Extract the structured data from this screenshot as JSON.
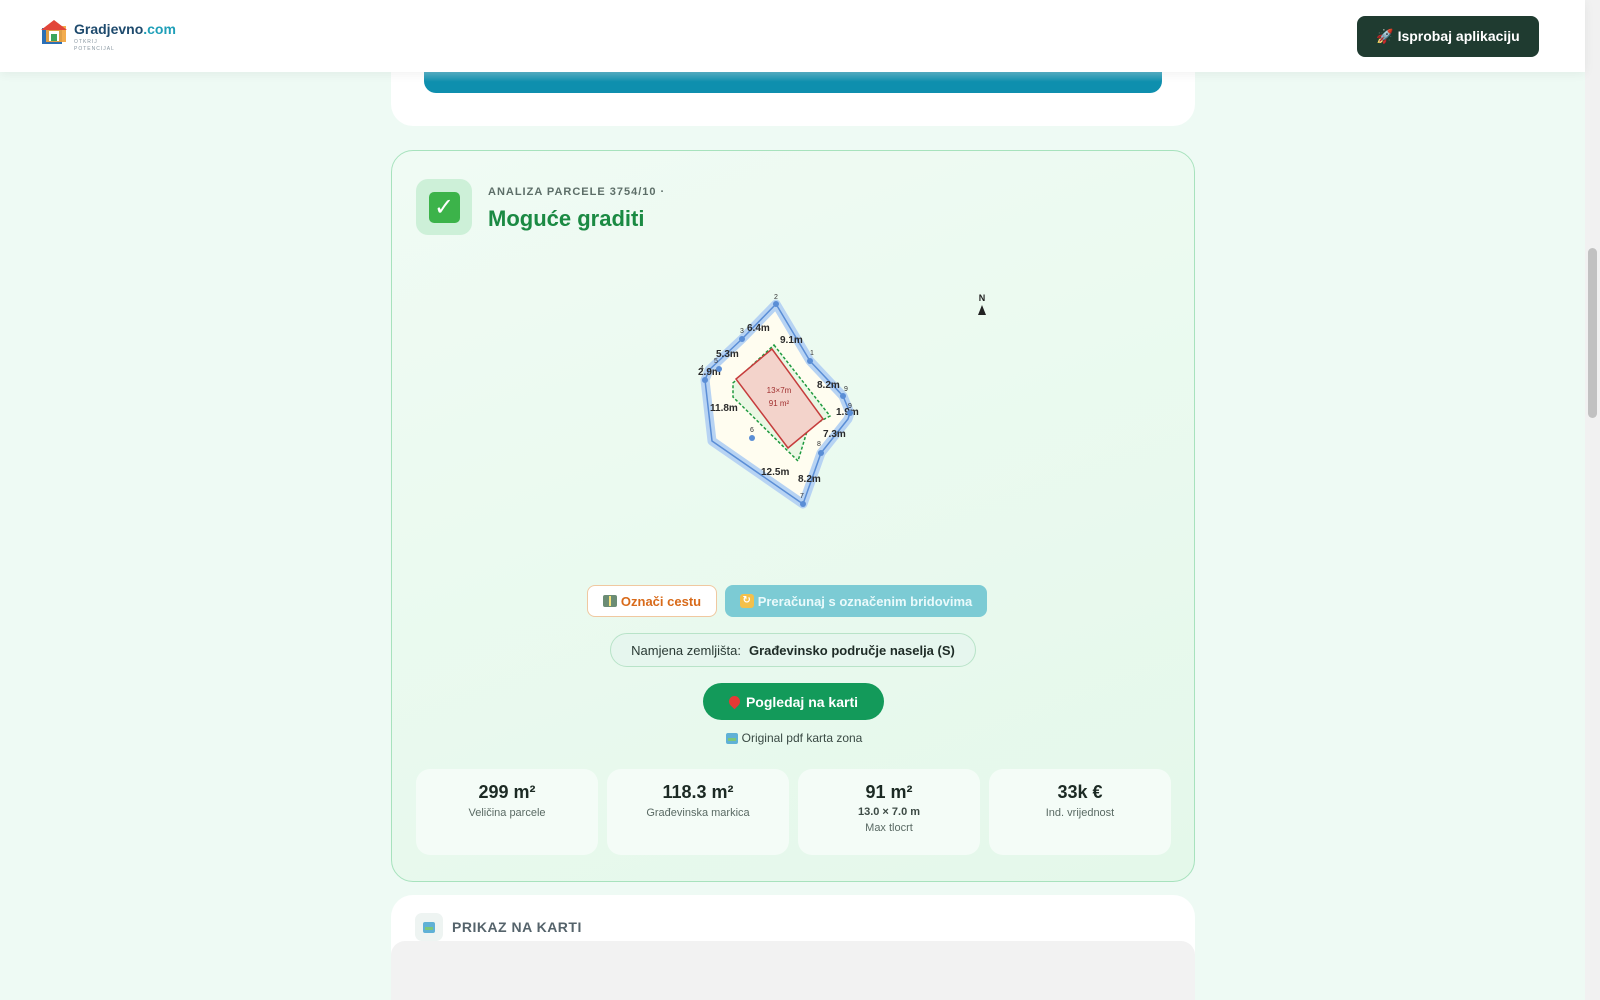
{
  "header": {
    "brand_name": "Gradjevno",
    "brand_domain": ".com",
    "brand_tagline": "OTKRIJ POTENCIJAL",
    "cta_label": "🚀 Isprobaj aplikaciju"
  },
  "analysis": {
    "parcel_label": "ANALIZA PARCELE 3754/10 ·",
    "status_title": "Moguće graditi",
    "status_icon": "check-icon",
    "diagram": {
      "north_label": "N",
      "footprint_dims": "13×7m",
      "footprint_area": "91 m²",
      "edge_labels": [
        "9.1m",
        "8.2m",
        "1.9m",
        "7.3m",
        "8.2m",
        "12.5m",
        "11.8m",
        "2.9m",
        "5.3m",
        "6.4m"
      ],
      "vertex_labels": [
        "1",
        "2",
        "3",
        "4",
        "5",
        "6",
        "7",
        "8",
        "9",
        "9"
      ]
    },
    "buttons": {
      "mark_road": "Označi cestu",
      "recalculate": "Preračunaj s označenim bridovima",
      "view_map": "Pogledaj na karti",
      "pdf_link": "Original pdf karta zona"
    },
    "zone": {
      "label": "Namjena zemljišta:",
      "value": "Građevinsko područje naselja (S)"
    },
    "stats": [
      {
        "value": "299 m²",
        "label": "Veličina parcele",
        "sub": ""
      },
      {
        "value": "118.3 m²",
        "label": "Građevinska markica",
        "sub": ""
      },
      {
        "value": "91 m²",
        "label": "Max tlocrt",
        "sub": "13.0 × 7.0 m"
      },
      {
        "value": "33k €",
        "label": "Ind. vrijednost",
        "sub": ""
      }
    ]
  },
  "map_section": {
    "title": "PRIKAZ NA KARTI"
  },
  "colors": {
    "accent_green": "#1b8a43",
    "button_green": "#139a5a",
    "dark_cta": "#1f3b30",
    "teal": "#0e8fae"
  }
}
